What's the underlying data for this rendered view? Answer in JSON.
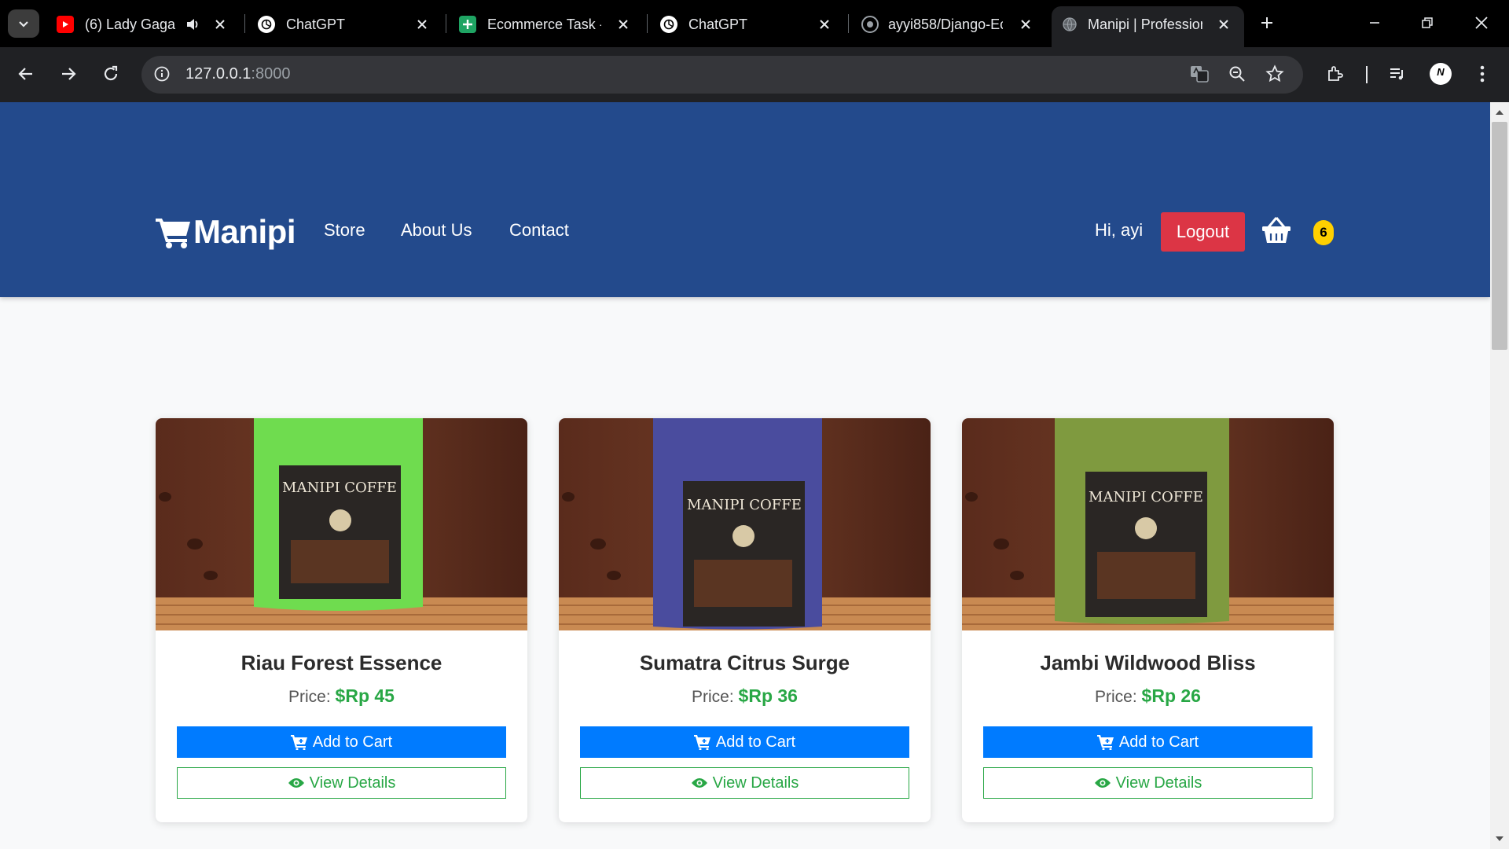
{
  "browser": {
    "tabs": [
      {
        "title": "(6) Lady Gaga, ",
        "favicon": "youtube-icon",
        "audio": true,
        "active": false
      },
      {
        "title": "ChatGPT",
        "favicon": "chatgpt-icon",
        "active": false
      },
      {
        "title": "Ecommerce Task - ",
        "favicon": "sheets-icon",
        "active": false
      },
      {
        "title": "ChatGPT",
        "favicon": "chatgpt-icon",
        "active": false
      },
      {
        "title": "ayyi858/Django-Ec",
        "favicon": "github-icon",
        "active": false
      },
      {
        "title": "Manipi | Profession",
        "favicon": "globe-icon",
        "active": true
      }
    ],
    "url_host": "127.0.0.1",
    "url_port": ":8000",
    "avatar_letter": "N"
  },
  "site": {
    "brand": "Manipi",
    "nav": {
      "store": "Store",
      "about": "About Us",
      "contact": "Contact"
    },
    "greeting": "Hi, ayi",
    "logout_label": "Logout",
    "cart_count": "6",
    "colors": {
      "navbar": "#234a8c",
      "logout": "#dc3545",
      "badge": "#ffd000",
      "primary": "#007bff",
      "success": "#28a745"
    }
  },
  "products": [
    {
      "name": "Riau Forest Essence",
      "price_label": "Price:",
      "price": "$Rp 45",
      "add_label": "Add to Cart",
      "view_label": "View Details",
      "bag_color": "#6fdc4f"
    },
    {
      "name": "Sumatra Citrus Surge",
      "price_label": "Price:",
      "price": "$Rp 36",
      "add_label": "Add to Cart",
      "view_label": "View Details",
      "bag_color": "#4a4c9e"
    },
    {
      "name": "Jambi Wildwood Bliss",
      "price_label": "Price:",
      "price": "$Rp 26",
      "add_label": "Add to Cart",
      "view_label": "View Details",
      "bag_color": "#7f9a3f"
    }
  ],
  "packaging_text": "MANIPI COFFE"
}
